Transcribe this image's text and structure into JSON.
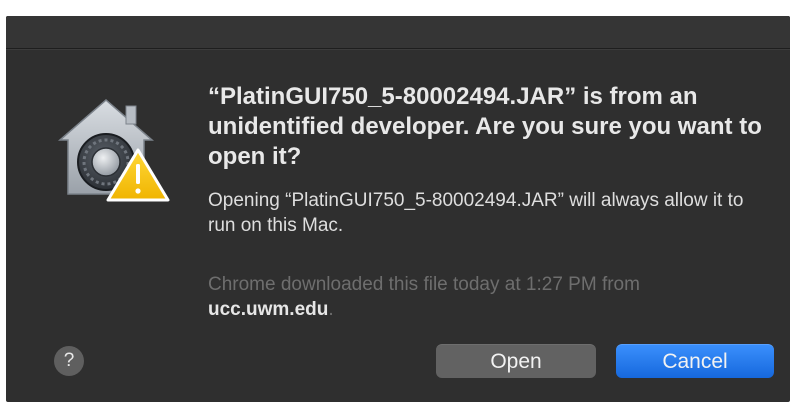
{
  "dialog": {
    "heading": "“PlatinGUI750_5-80002494.JAR” is from an unidentified developer. Are you sure you want to open it?",
    "message": "Opening “PlatinGUI750_5-80002494.JAR” will always allow it to run on this Mac.",
    "source_prefix": "Chrome downloaded this file today at 1:27 PM from",
    "source_domain": "ucc.uwm.edu",
    "source_suffix": ".",
    "help_label": "?",
    "open_label": "Open",
    "cancel_label": "Cancel"
  },
  "icons": {
    "app_icon": "gatekeeper-security-icon",
    "warning_badge": "warning-icon",
    "help": "question-icon"
  },
  "colors": {
    "dialog_background": "#2f2f2f",
    "default_button": "#1668dd",
    "secondary_button": "#626262",
    "warning": "#f5c400"
  }
}
